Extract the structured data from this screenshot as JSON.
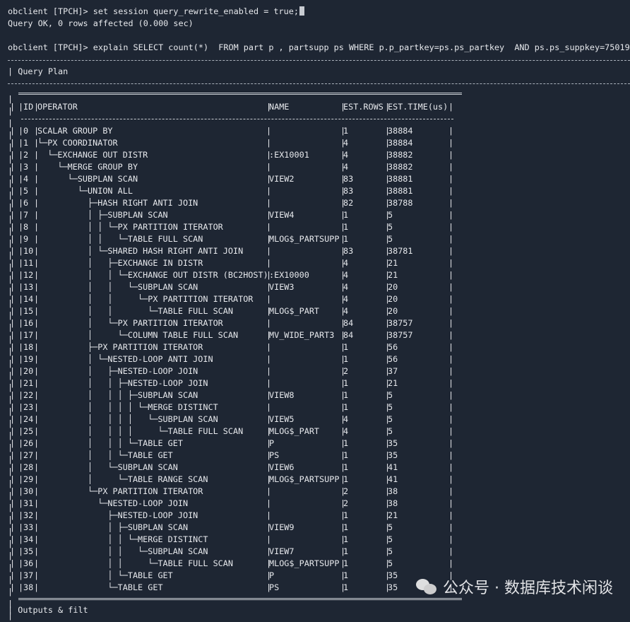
{
  "terminal": {
    "line1": "obclient [TPCH]> set session query_rewrite_enabled = true;",
    "line2": "Query OK, 0 rows affected (0.000 sec)",
    "line3": "obclient [TPCH]> explain SELECT count(*)  FROM part p , partsupp ps WHERE p.p_partkey=ps.ps_partkey  AND ps.ps_suppkey=75019;",
    "header_label": "Query Plan",
    "footer_partial": "Outputs & filt"
  },
  "plan": {
    "columns": [
      "ID",
      "OPERATOR",
      "NAME",
      "EST.ROWS",
      "EST.TIME(us)"
    ],
    "rows": [
      {
        "id": "0",
        "op": "SCALAR GROUP BY",
        "name": "",
        "rows": "1",
        "time": "38884"
      },
      {
        "id": "1",
        "op": "└─PX COORDINATOR",
        "name": "",
        "rows": "4",
        "time": "38884"
      },
      {
        "id": "2",
        "op": "  └─EXCHANGE OUT DISTR",
        "name": ":EX10001",
        "rows": "4",
        "time": "38882"
      },
      {
        "id": "3",
        "op": "    └─MERGE GROUP BY",
        "name": "",
        "rows": "4",
        "time": "38882"
      },
      {
        "id": "4",
        "op": "      └─SUBPLAN SCAN",
        "name": "VIEW2",
        "rows": "83",
        "time": "38881"
      },
      {
        "id": "5",
        "op": "        └─UNION ALL",
        "name": "",
        "rows": "83",
        "time": "38881"
      },
      {
        "id": "6",
        "op": "          ├─HASH RIGHT ANTI JOIN",
        "name": "",
        "rows": "82",
        "time": "38788"
      },
      {
        "id": "7",
        "op": "          │ ├─SUBPLAN SCAN",
        "name": "VIEW4",
        "rows": "1",
        "time": "5"
      },
      {
        "id": "8",
        "op": "          │ │ └─PX PARTITION ITERATOR",
        "name": "",
        "rows": "1",
        "time": "5"
      },
      {
        "id": "9",
        "op": "          │ │   └─TABLE FULL SCAN",
        "name": "MLOG$_PARTSUPP",
        "rows": "1",
        "time": "5"
      },
      {
        "id": "10",
        "op": "          │ └─SHARED HASH RIGHT ANTI JOIN",
        "name": "",
        "rows": "83",
        "time": "38781"
      },
      {
        "id": "11",
        "op": "          │   ├─EXCHANGE IN DISTR",
        "name": "",
        "rows": "4",
        "time": "21"
      },
      {
        "id": "12",
        "op": "          │   │ └─EXCHANGE OUT DISTR (BC2HOST)",
        "name": ":EX10000",
        "rows": "4",
        "time": "21"
      },
      {
        "id": "13",
        "op": "          │   │   └─SUBPLAN SCAN",
        "name": "VIEW3",
        "rows": "4",
        "time": "20"
      },
      {
        "id": "14",
        "op": "          │   │     └─PX PARTITION ITERATOR",
        "name": "",
        "rows": "4",
        "time": "20"
      },
      {
        "id": "15",
        "op": "          │   │       └─TABLE FULL SCAN",
        "name": "MLOG$_PART",
        "rows": "4",
        "time": "20"
      },
      {
        "id": "16",
        "op": "          │   └─PX PARTITION ITERATOR",
        "name": "",
        "rows": "84",
        "time": "38757"
      },
      {
        "id": "17",
        "op": "          │     └─COLUMN TABLE FULL SCAN",
        "name": "MV_WIDE_PART3",
        "rows": "84",
        "time": "38757"
      },
      {
        "id": "18",
        "op": "          ├─PX PARTITION ITERATOR",
        "name": "",
        "rows": "1",
        "time": "56"
      },
      {
        "id": "19",
        "op": "          │ └─NESTED-LOOP ANTI JOIN",
        "name": "",
        "rows": "1",
        "time": "56"
      },
      {
        "id": "20",
        "op": "          │   ├─NESTED-LOOP JOIN",
        "name": "",
        "rows": "2",
        "time": "37"
      },
      {
        "id": "21",
        "op": "          │   │ ├─NESTED-LOOP JOIN",
        "name": "",
        "rows": "1",
        "time": "21"
      },
      {
        "id": "22",
        "op": "          │   │ │ ├─SUBPLAN SCAN",
        "name": "VIEW8",
        "rows": "1",
        "time": "5"
      },
      {
        "id": "23",
        "op": "          │   │ │ │ └─MERGE DISTINCT",
        "name": "",
        "rows": "1",
        "time": "5"
      },
      {
        "id": "24",
        "op": "          │   │ │ │   └─SUBPLAN SCAN",
        "name": "VIEW5",
        "rows": "4",
        "time": "5"
      },
      {
        "id": "25",
        "op": "          │   │ │ │     └─TABLE FULL SCAN",
        "name": "MLOG$_PART",
        "rows": "4",
        "time": "5"
      },
      {
        "id": "26",
        "op": "          │   │ │ └─TABLE GET",
        "name": "P",
        "rows": "1",
        "time": "35"
      },
      {
        "id": "27",
        "op": "          │   │ └─TABLE GET",
        "name": "PS",
        "rows": "1",
        "time": "35"
      },
      {
        "id": "28",
        "op": "          │   └─SUBPLAN SCAN",
        "name": "VIEW6",
        "rows": "1",
        "time": "41"
      },
      {
        "id": "29",
        "op": "          │     └─TABLE RANGE SCAN",
        "name": "MLOG$_PARTSUPP",
        "rows": "1",
        "time": "41"
      },
      {
        "id": "30",
        "op": "          └─PX PARTITION ITERATOR",
        "name": "",
        "rows": "2",
        "time": "38"
      },
      {
        "id": "31",
        "op": "            └─NESTED-LOOP JOIN",
        "name": "",
        "rows": "2",
        "time": "38"
      },
      {
        "id": "32",
        "op": "              ├─NESTED-LOOP JOIN",
        "name": "",
        "rows": "1",
        "time": "21"
      },
      {
        "id": "33",
        "op": "              │ ├─SUBPLAN SCAN",
        "name": "VIEW9",
        "rows": "1",
        "time": "5"
      },
      {
        "id": "34",
        "op": "              │ │ └─MERGE DISTINCT",
        "name": "",
        "rows": "1",
        "time": "5"
      },
      {
        "id": "35",
        "op": "              │ │   └─SUBPLAN SCAN",
        "name": "VIEW7",
        "rows": "1",
        "time": "5"
      },
      {
        "id": "36",
        "op": "              │ │     └─TABLE FULL SCAN",
        "name": "MLOG$_PARTSUPP",
        "rows": "1",
        "time": "5"
      },
      {
        "id": "37",
        "op": "              │ └─TABLE GET",
        "name": "P",
        "rows": "1",
        "time": "35"
      },
      {
        "id": "38",
        "op": "              └─TABLE GET",
        "name": "PS",
        "rows": "1",
        "time": "35"
      }
    ]
  },
  "watermark": {
    "text": "公众号 · 数据库技术闲谈",
    "icon": "wechat-icon"
  }
}
